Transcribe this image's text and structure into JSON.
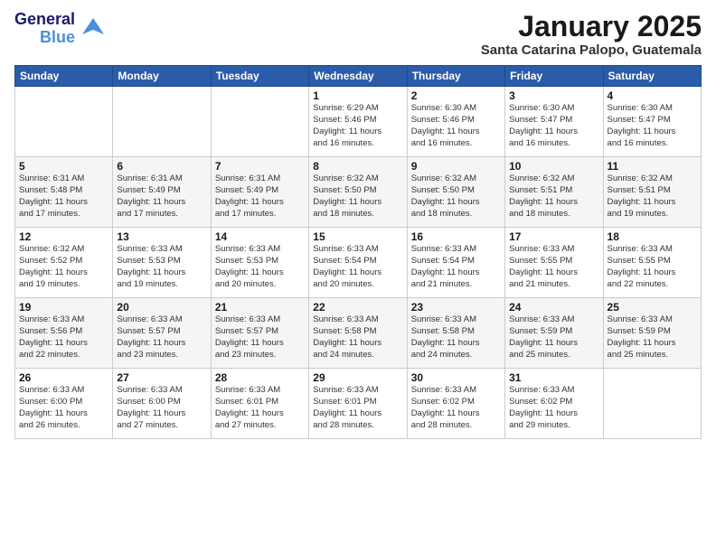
{
  "logo": {
    "line1": "General",
    "line2": "Blue",
    "bird": "▲"
  },
  "title": "January 2025",
  "subtitle": "Santa Catarina Palopo, Guatemala",
  "weekdays": [
    "Sunday",
    "Monday",
    "Tuesday",
    "Wednesday",
    "Thursday",
    "Friday",
    "Saturday"
  ],
  "weeks": [
    [
      {
        "day": "",
        "info": ""
      },
      {
        "day": "",
        "info": ""
      },
      {
        "day": "",
        "info": ""
      },
      {
        "day": "1",
        "info": "Sunrise: 6:29 AM\nSunset: 5:46 PM\nDaylight: 11 hours\nand 16 minutes."
      },
      {
        "day": "2",
        "info": "Sunrise: 6:30 AM\nSunset: 5:46 PM\nDaylight: 11 hours\nand 16 minutes."
      },
      {
        "day": "3",
        "info": "Sunrise: 6:30 AM\nSunset: 5:47 PM\nDaylight: 11 hours\nand 16 minutes."
      },
      {
        "day": "4",
        "info": "Sunrise: 6:30 AM\nSunset: 5:47 PM\nDaylight: 11 hours\nand 16 minutes."
      }
    ],
    [
      {
        "day": "5",
        "info": "Sunrise: 6:31 AM\nSunset: 5:48 PM\nDaylight: 11 hours\nand 17 minutes."
      },
      {
        "day": "6",
        "info": "Sunrise: 6:31 AM\nSunset: 5:49 PM\nDaylight: 11 hours\nand 17 minutes."
      },
      {
        "day": "7",
        "info": "Sunrise: 6:31 AM\nSunset: 5:49 PM\nDaylight: 11 hours\nand 17 minutes."
      },
      {
        "day": "8",
        "info": "Sunrise: 6:32 AM\nSunset: 5:50 PM\nDaylight: 11 hours\nand 18 minutes."
      },
      {
        "day": "9",
        "info": "Sunrise: 6:32 AM\nSunset: 5:50 PM\nDaylight: 11 hours\nand 18 minutes."
      },
      {
        "day": "10",
        "info": "Sunrise: 6:32 AM\nSunset: 5:51 PM\nDaylight: 11 hours\nand 18 minutes."
      },
      {
        "day": "11",
        "info": "Sunrise: 6:32 AM\nSunset: 5:51 PM\nDaylight: 11 hours\nand 19 minutes."
      }
    ],
    [
      {
        "day": "12",
        "info": "Sunrise: 6:32 AM\nSunset: 5:52 PM\nDaylight: 11 hours\nand 19 minutes."
      },
      {
        "day": "13",
        "info": "Sunrise: 6:33 AM\nSunset: 5:53 PM\nDaylight: 11 hours\nand 19 minutes."
      },
      {
        "day": "14",
        "info": "Sunrise: 6:33 AM\nSunset: 5:53 PM\nDaylight: 11 hours\nand 20 minutes."
      },
      {
        "day": "15",
        "info": "Sunrise: 6:33 AM\nSunset: 5:54 PM\nDaylight: 11 hours\nand 20 minutes."
      },
      {
        "day": "16",
        "info": "Sunrise: 6:33 AM\nSunset: 5:54 PM\nDaylight: 11 hours\nand 21 minutes."
      },
      {
        "day": "17",
        "info": "Sunrise: 6:33 AM\nSunset: 5:55 PM\nDaylight: 11 hours\nand 21 minutes."
      },
      {
        "day": "18",
        "info": "Sunrise: 6:33 AM\nSunset: 5:55 PM\nDaylight: 11 hours\nand 22 minutes."
      }
    ],
    [
      {
        "day": "19",
        "info": "Sunrise: 6:33 AM\nSunset: 5:56 PM\nDaylight: 11 hours\nand 22 minutes."
      },
      {
        "day": "20",
        "info": "Sunrise: 6:33 AM\nSunset: 5:57 PM\nDaylight: 11 hours\nand 23 minutes."
      },
      {
        "day": "21",
        "info": "Sunrise: 6:33 AM\nSunset: 5:57 PM\nDaylight: 11 hours\nand 23 minutes."
      },
      {
        "day": "22",
        "info": "Sunrise: 6:33 AM\nSunset: 5:58 PM\nDaylight: 11 hours\nand 24 minutes."
      },
      {
        "day": "23",
        "info": "Sunrise: 6:33 AM\nSunset: 5:58 PM\nDaylight: 11 hours\nand 24 minutes."
      },
      {
        "day": "24",
        "info": "Sunrise: 6:33 AM\nSunset: 5:59 PM\nDaylight: 11 hours\nand 25 minutes."
      },
      {
        "day": "25",
        "info": "Sunrise: 6:33 AM\nSunset: 5:59 PM\nDaylight: 11 hours\nand 25 minutes."
      }
    ],
    [
      {
        "day": "26",
        "info": "Sunrise: 6:33 AM\nSunset: 6:00 PM\nDaylight: 11 hours\nand 26 minutes."
      },
      {
        "day": "27",
        "info": "Sunrise: 6:33 AM\nSunset: 6:00 PM\nDaylight: 11 hours\nand 27 minutes."
      },
      {
        "day": "28",
        "info": "Sunrise: 6:33 AM\nSunset: 6:01 PM\nDaylight: 11 hours\nand 27 minutes."
      },
      {
        "day": "29",
        "info": "Sunrise: 6:33 AM\nSunset: 6:01 PM\nDaylight: 11 hours\nand 28 minutes."
      },
      {
        "day": "30",
        "info": "Sunrise: 6:33 AM\nSunset: 6:02 PM\nDaylight: 11 hours\nand 28 minutes."
      },
      {
        "day": "31",
        "info": "Sunrise: 6:33 AM\nSunset: 6:02 PM\nDaylight: 11 hours\nand 29 minutes."
      },
      {
        "day": "",
        "info": ""
      }
    ]
  ]
}
